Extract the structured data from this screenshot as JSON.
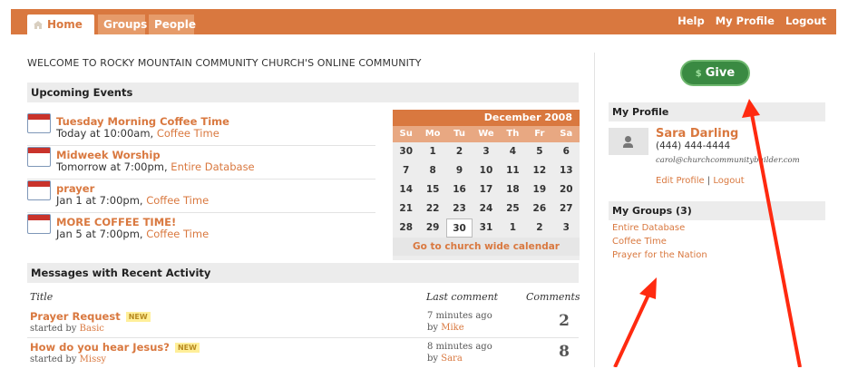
{
  "nav": {
    "tabs": [
      {
        "label": "Home"
      },
      {
        "label": "Groups"
      },
      {
        "label": "People"
      }
    ],
    "links": [
      {
        "label": "Help"
      },
      {
        "label": "My Profile"
      },
      {
        "label": "Logout"
      }
    ]
  },
  "welcome": "WELCOME TO ROCKY MOUNTAIN COMMUNITY CHURCH'S ONLINE COMMUNITY",
  "events": {
    "heading": "Upcoming Events",
    "items": [
      {
        "title": "Tuesday Morning Coffee Time",
        "when": "Today at 10:00am, ",
        "group": "Coffee Time"
      },
      {
        "title": "Midweek Worship",
        "when": "Tomorrow at 7:00pm, ",
        "group": "Entire Database"
      },
      {
        "title": "prayer",
        "when": "Jan 1 at 7:00pm, ",
        "group": "Coffee Time"
      },
      {
        "title": "MORE COFFEE TIME!",
        "when": "Jan 5 at 7:00pm, ",
        "group": "Coffee Time"
      }
    ]
  },
  "calendar": {
    "month": "December 2008",
    "days": [
      "Su",
      "Mo",
      "Tu",
      "We",
      "Th",
      "Fr",
      "Sa"
    ],
    "dates": [
      "30",
      "1",
      "2",
      "3",
      "4",
      "5",
      "6",
      "7",
      "8",
      "9",
      "10",
      "11",
      "12",
      "13",
      "14",
      "15",
      "16",
      "17",
      "18",
      "19",
      "20",
      "21",
      "22",
      "23",
      "24",
      "25",
      "26",
      "27",
      "28",
      "29",
      "30",
      "31",
      "1",
      "2",
      "3"
    ],
    "today_index": 30,
    "link": "Go to church wide calendar"
  },
  "messages": {
    "heading": "Messages with Recent Activity",
    "col_title": "Title",
    "col_last": "Last comment",
    "col_comments": "Comments",
    "items": [
      {
        "title": "Prayer Request",
        "badge": "NEW",
        "by_label": "started by ",
        "by": "Basic",
        "when": "7 minutes ago",
        "last_label": "by ",
        "last_by": "Mike",
        "count": "2"
      },
      {
        "title": "How do you hear Jesus?",
        "badge": "NEW",
        "by_label": "started by ",
        "by": "Missy",
        "when": "8 minutes ago",
        "last_label": "by ",
        "last_by": "Sara",
        "count": "8"
      }
    ]
  },
  "give_label": "Give",
  "give_symbol": "$",
  "profile": {
    "heading": "My Profile",
    "name": "Sara Darling",
    "phone": "(444) 444-4444",
    "email": "carol@churchcommunitybuilder.com",
    "edit": "Edit Profile",
    "sep": "|",
    "logout": "Logout"
  },
  "groups": {
    "heading": "My Groups (3)",
    "items": [
      {
        "label": "Entire Database"
      },
      {
        "label": "Coffee Time"
      },
      {
        "label": "Prayer for the Nation"
      }
    ]
  },
  "colors": {
    "accent": "#d9783f",
    "give": "#3a8a42",
    "annotation_arrow": "#ff2a10"
  }
}
